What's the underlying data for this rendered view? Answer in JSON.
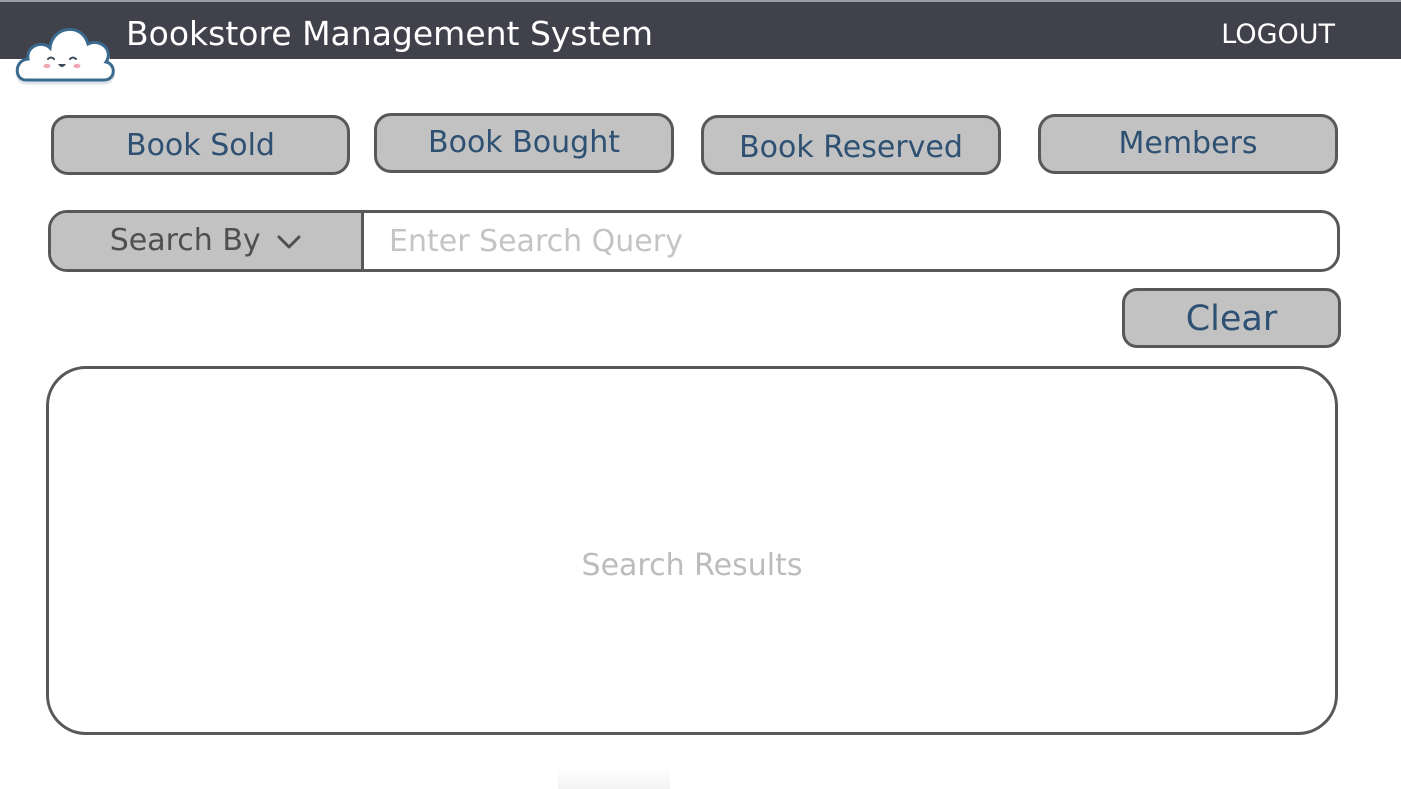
{
  "header": {
    "title": "Bookstore Management System",
    "logout_label": "LOGOUT",
    "background": "#40414b"
  },
  "logo": {
    "icon": "cloud-face-icon"
  },
  "nav": {
    "book_sold": "Book Sold",
    "book_bought": "Book Bought",
    "book_reserved": "Book Reserved",
    "members": "Members"
  },
  "search": {
    "by_label": "Search By",
    "placeholder": "Enter Search Query",
    "value": ""
  },
  "clear_label": "Clear",
  "results": {
    "placeholder": "Search Results"
  },
  "colors": {
    "button_bg": "#c2c2c2",
    "button_text": "#2e5173",
    "border": "#585858"
  }
}
